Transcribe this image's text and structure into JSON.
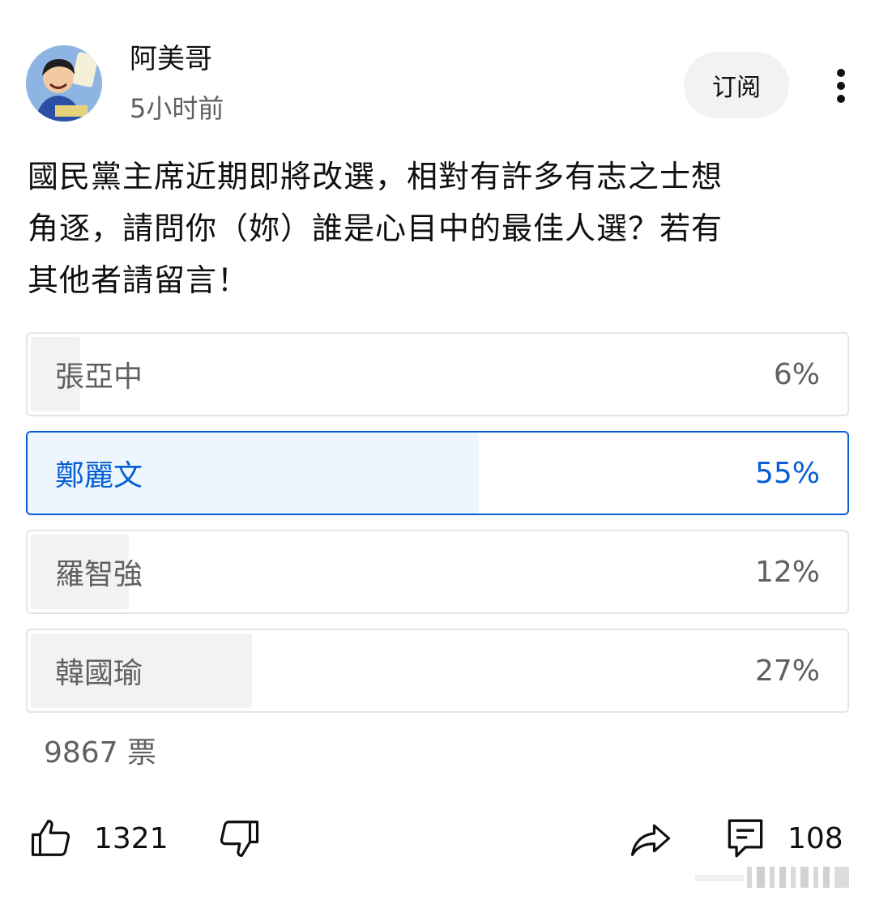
{
  "post": {
    "author": "阿美哥",
    "time": "5小时前",
    "subscribe_label": "订阅",
    "text_lines": [
      "國民黨主席近期即將改選，相對有許多有志之士想",
      "角逐，請問你（妳）誰是心目中的最佳人選？若有",
      "其他者請留言！"
    ]
  },
  "poll": {
    "options": [
      {
        "label": "張亞中",
        "percent_text": "6%",
        "share": 0.06,
        "selected": false
      },
      {
        "label": "鄭麗文",
        "percent_text": "55%",
        "share": 0.55,
        "selected": true
      },
      {
        "label": "羅智強",
        "percent_text": "12%",
        "share": 0.12,
        "selected": false
      },
      {
        "label": "韓國瑜",
        "percent_text": "27%",
        "share": 0.27,
        "selected": false
      }
    ],
    "votes": "9867 票"
  },
  "actions": {
    "likes": "1321",
    "comments": "108",
    "icons": [
      "thumbs-up-icon",
      "thumbs-down-icon",
      "share-icon",
      "comment-icon"
    ]
  },
  "colors": {
    "accent": "#065fd4",
    "selected_fill": "#eef6fd",
    "option_fill": "#f2f2f2",
    "secondary_text": "#606060"
  }
}
